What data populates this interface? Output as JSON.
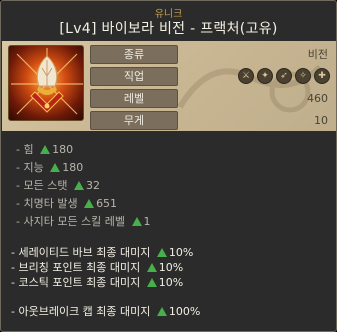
{
  "rarity": "유니크",
  "title": "[Lv4] 바이보라 비전 - 프랙처(고유)",
  "info": [
    {
      "label": "종류",
      "value": "비전"
    },
    {
      "label": "직업",
      "value": ""
    },
    {
      "label": "레벨",
      "value": "460"
    },
    {
      "label": "무게",
      "value": "10"
    }
  ],
  "class_icons": [
    "warrior-icon",
    "mage-icon",
    "archer-icon",
    "thief-icon",
    "pirate-icon"
  ],
  "stats": [
    {
      "label": "- 힘",
      "value": "180"
    },
    {
      "label": "- 지능",
      "value": "180"
    },
    {
      "label": "- 모든 스탯",
      "value": "32"
    },
    {
      "label": "- 치명타 발생",
      "value": "651"
    },
    {
      "label": "- 사지타 모든 스킬 레벨",
      "value": "1"
    }
  ],
  "bonuses": [
    {
      "label": "- 세레이티드 바브 최종 대미지",
      "value": "10%"
    },
    {
      "label": "- 브리칭 포인트 최종 대미지",
      "value": "10%"
    },
    {
      "label": "- 코스틱 포인트 최종 대미지",
      "value": "10%"
    },
    {
      "label": "- 아웃브레이크 캡 최종 대미지",
      "value": "100%"
    }
  ],
  "colors": {
    "increase": "#46b04a",
    "rarity": "#c9a04a"
  }
}
